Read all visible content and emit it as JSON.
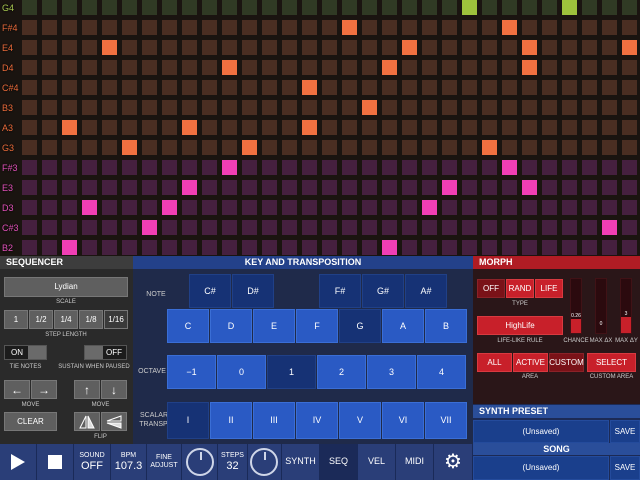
{
  "grid": {
    "notes": [
      "G4",
      "F#4",
      "E4",
      "D4",
      "C#4",
      "B3",
      "A3",
      "G3",
      "F#3",
      "E3",
      "D3",
      "C#3",
      "B2"
    ],
    "colors": {
      "G4": {
        "base": "#303a24",
        "on": "#9ec23c"
      },
      "F#4": {
        "base": "#4a2e22",
        "on": "#f07040"
      },
      "E4": {
        "base": "#4a2e22",
        "on": "#f07040"
      },
      "D4": {
        "base": "#4a2e22",
        "on": "#f07040"
      },
      "C#4": {
        "base": "#4a2e22",
        "on": "#f07040"
      },
      "B3": {
        "base": "#4a2e22",
        "on": "#f07040"
      },
      "A3": {
        "base": "#4a2e22",
        "on": "#f07040"
      },
      "G3": {
        "base": "#4a2e22",
        "on": "#f07040"
      },
      "F#3": {
        "base": "#45203f",
        "on": "#f03eb4"
      },
      "E3": {
        "base": "#45203f",
        "on": "#f03eb4"
      },
      "D3": {
        "base": "#45203f",
        "on": "#f03eb4"
      },
      "C#3": {
        "base": "#45203f",
        "on": "#f03eb4"
      },
      "B2": {
        "base": "#45203f",
        "on": "#f03eb4"
      }
    },
    "active": {
      "G4": [
        22,
        27
      ],
      "F#4": [
        16,
        24
      ],
      "E4": [
        4,
        19,
        25,
        30
      ],
      "D4": [
        10,
        18,
        25
      ],
      "C#4": [
        14
      ],
      "B3": [
        17
      ],
      "A3": [
        2,
        8,
        14
      ],
      "G3": [
        5,
        11,
        23
      ],
      "F#3": [
        10,
        24
      ],
      "E3": [
        8,
        21,
        25
      ],
      "D3": [
        3,
        7,
        20
      ],
      "C#3": [
        6,
        29
      ],
      "B2": [
        2,
        18
      ]
    },
    "label_colors": {
      "upper": "#e86a3a",
      "lower": "#e050b8",
      "top": "#a8c850"
    }
  },
  "sequencer": {
    "title": "SEQUENCER",
    "scale_value": "Lydian",
    "scale_label": "SCALE",
    "step_lengths": [
      "1",
      "1/2",
      "1/4",
      "1/8",
      "1/16"
    ],
    "step_length_label": "STEP LENGTH",
    "tie_notes_value": "ON",
    "tie_notes_label": "TIE NOTES",
    "sustain_value": "OFF",
    "sustain_label": "SUSTAIN WHEN PAUSED",
    "left_arrow": "←",
    "right_arrow": "→",
    "up_arrow": "↑",
    "down_arrow": "↓",
    "move_label": "MOVE",
    "clear_label": "CLEAR",
    "flip_label": "FLIP"
  },
  "key": {
    "title": "KEY AND TRANSPOSITION",
    "note_label": "NOTE",
    "sharps": [
      "C#",
      "D#",
      "F#",
      "G#",
      "A#"
    ],
    "naturals": [
      "C",
      "D",
      "E",
      "F",
      "G",
      "A",
      "B"
    ],
    "octave_label": "OCTAVE",
    "octaves": [
      "−1",
      "0",
      "1",
      "2",
      "3",
      "4"
    ],
    "scalar_label": "SCALAR TRANSP.",
    "scalars": [
      "I",
      "II",
      "III",
      "IV",
      "V",
      "VI",
      "VII"
    ]
  },
  "morph": {
    "title": "MORPH",
    "types": [
      "OFF",
      "RAND",
      "LIFE"
    ],
    "type_label": "TYPE",
    "rule_value": "HighLife",
    "rule_label": "LIFE-LIKE RULE",
    "areas": [
      "ALL",
      "ACTIVE",
      "CUSTOM"
    ],
    "area_label": "AREA",
    "select_label": "SELECT",
    "custom_area_label": "CUSTOM AREA",
    "chance_value": "0.26",
    "chance_level": 0.26,
    "chance_label": "CHANCE",
    "max_dx_value": "0",
    "max_dx_level": 0.0,
    "max_dx_label": "MAX ΔX",
    "max_dy_value": "3",
    "max_dy_level": 0.3,
    "max_dy_label": "MAX ΔY"
  },
  "synth_preset": {
    "title": "SYNTH PRESET",
    "value": "(Unsaved)",
    "save": "SAVE"
  },
  "song": {
    "title": "SONG",
    "value": "(Unsaved)",
    "save": "SAVE"
  },
  "bottom": {
    "sound_label": "SOUND",
    "sound_value": "OFF",
    "bpm_label": "BPM",
    "bpm_value": "107.3",
    "fine_label": "FINE",
    "adjust_label": "ADJUST",
    "steps_label": "STEPS",
    "steps_value": "32",
    "synth": "SYNTH",
    "seq": "SEQ",
    "vel": "VEL",
    "midi": "MIDI"
  }
}
